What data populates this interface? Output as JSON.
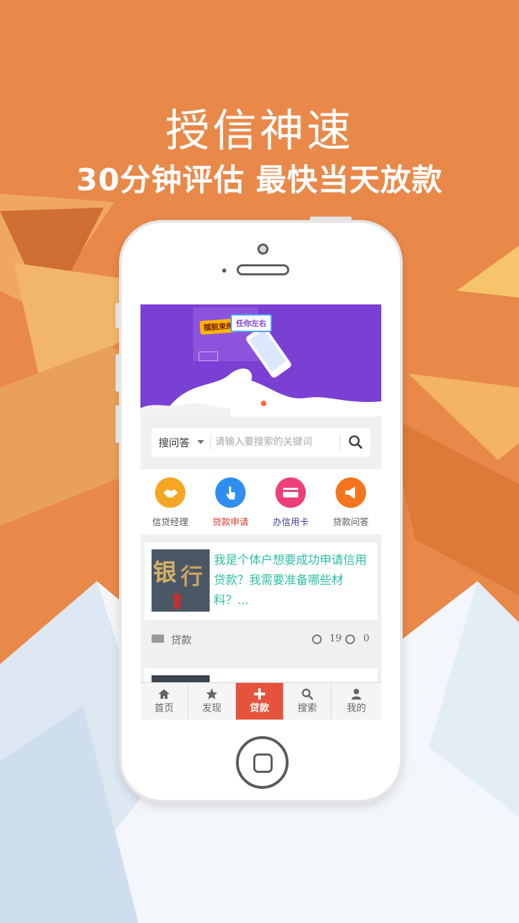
{
  "hero": {
    "title": "授信神速",
    "subtitle": "30分钟评估 最快当天放款"
  },
  "banner": {
    "tag_left": "摆脱束缚",
    "tag_right": "任你左右"
  },
  "search": {
    "category": "搜问答",
    "placeholder": "请输入要搜索的关键词"
  },
  "quick_actions": [
    {
      "label": "信贷经理",
      "color": "#f5a623",
      "label_color": "#555555"
    },
    {
      "label": "贷款申请",
      "color": "#2f8ff0",
      "label_color": "#e0352b"
    },
    {
      "label": "办信用卡",
      "color": "#ee3f7a",
      "label_color": "#3a3a9a"
    },
    {
      "label": "贷款问答",
      "color": "#f5751f",
      "label_color": "#555555"
    }
  ],
  "article": {
    "thumb_text_1": "银",
    "thumb_text_2": "行",
    "title": "我是个体户想要成功申请信用贷款？我需要准备哪些材料？...",
    "category": "贷款",
    "views": "19",
    "comments": "0"
  },
  "tabbar": {
    "items": [
      {
        "label": "首页",
        "icon": "home-icon"
      },
      {
        "label": "发现",
        "icon": "star-icon"
      },
      {
        "label": "贷款",
        "icon": "plus-icon"
      },
      {
        "label": "搜索",
        "icon": "search-icon"
      },
      {
        "label": "我的",
        "icon": "user-icon"
      }
    ],
    "active_index": 2
  },
  "colors": {
    "background": "#e8894a",
    "accent_teal": "#2bbfa4",
    "tab_active": "#e5533c",
    "banner_purple": "#7a3fd3"
  }
}
